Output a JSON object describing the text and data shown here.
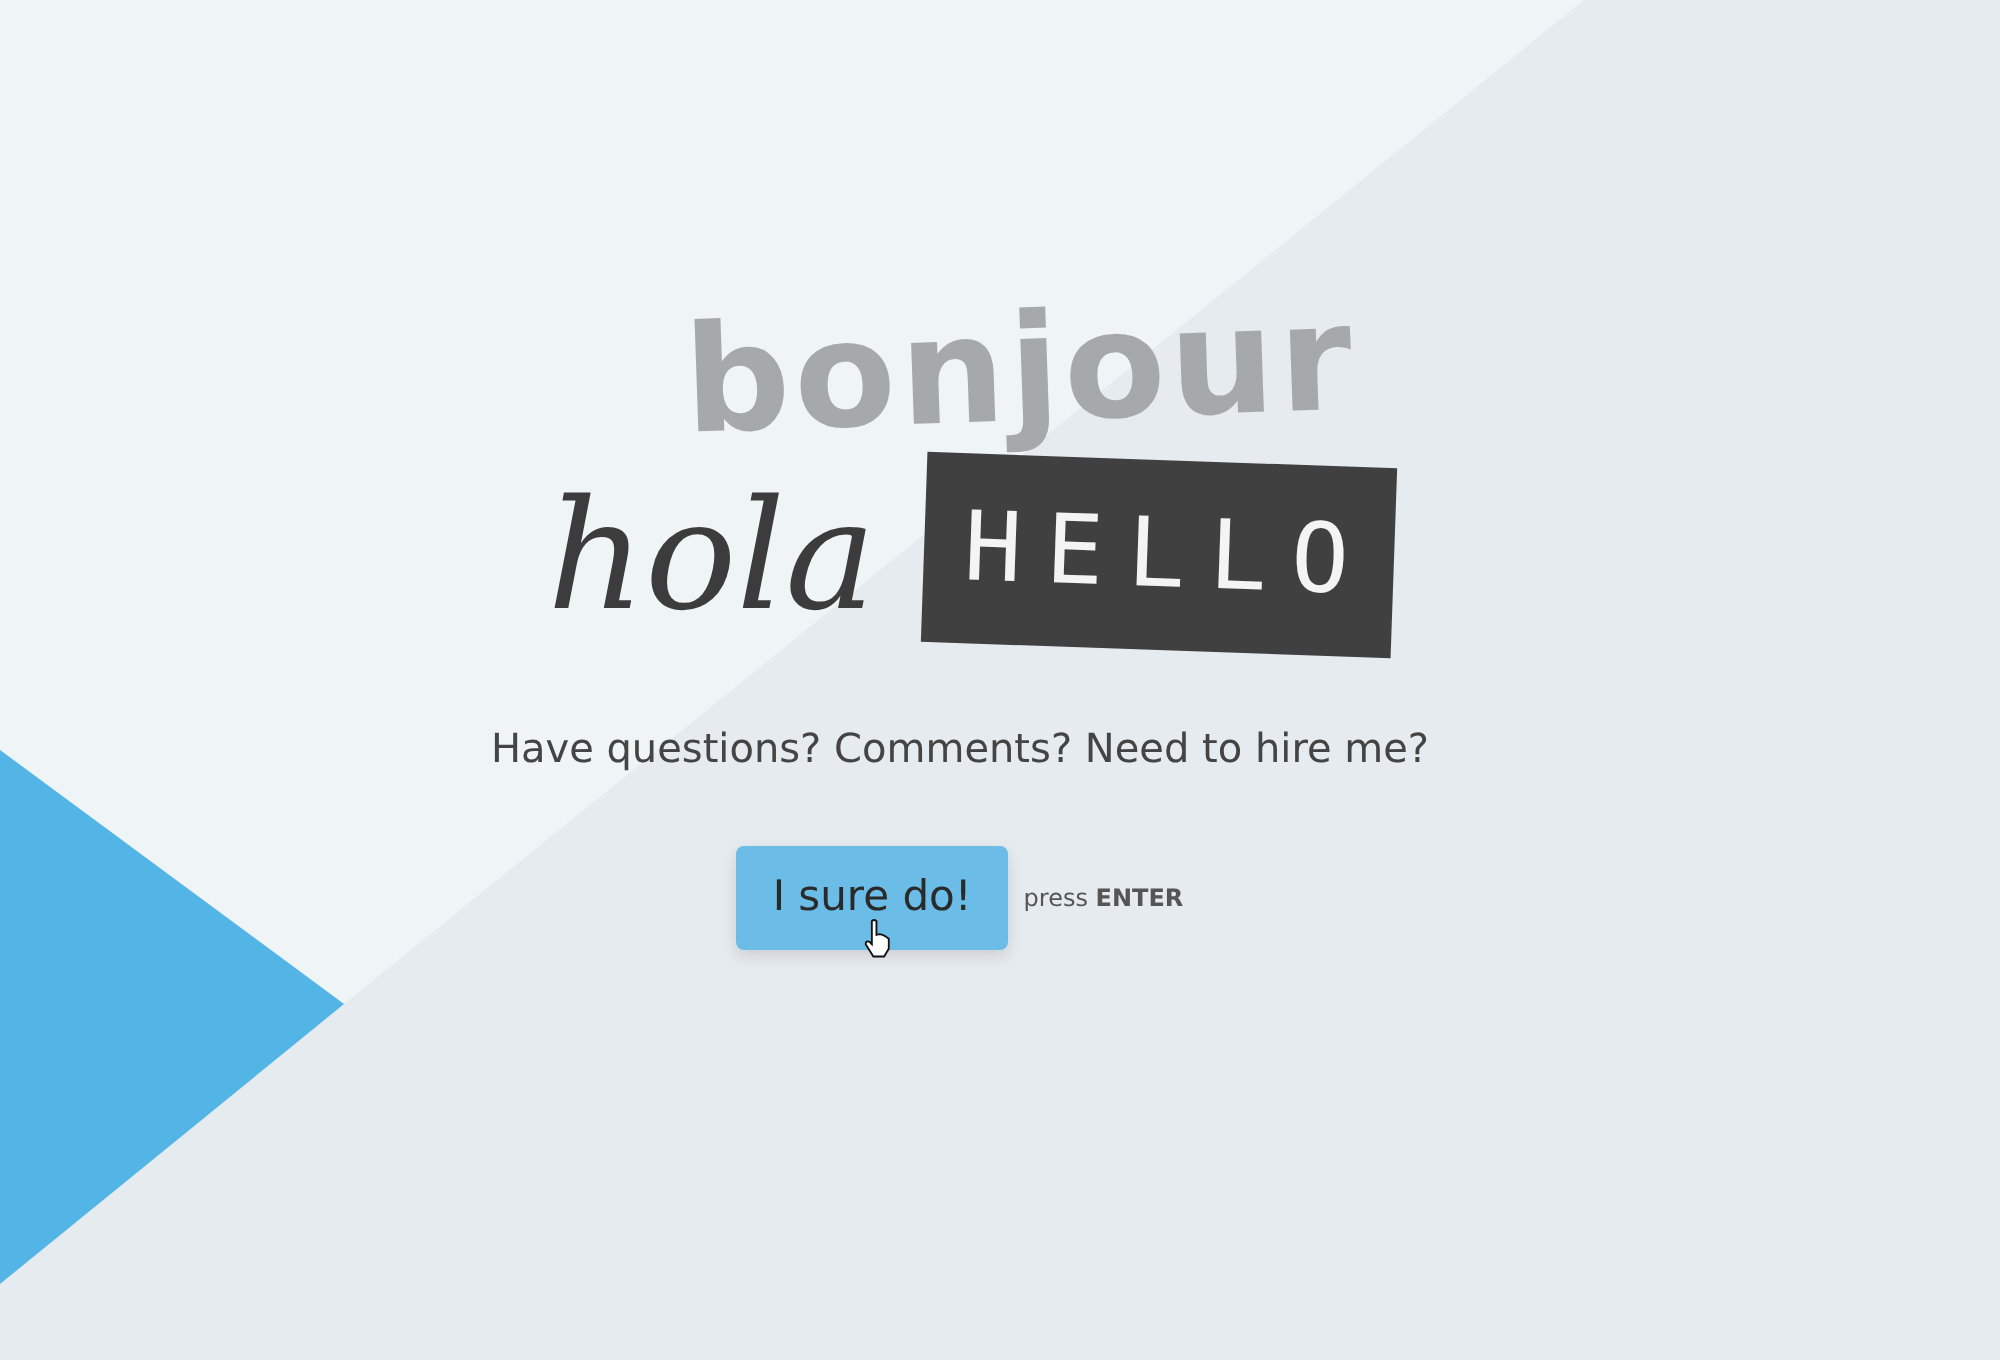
{
  "greetings": [
    {
      "text": "bonjour",
      "kind": "brush"
    },
    {
      "text": "hola",
      "kind": "script"
    },
    {
      "text": "HELLO",
      "kind": "label"
    }
  ],
  "prompt": "Have questions? Comments? Need to hire me?",
  "button": {
    "label": "I sure do!"
  },
  "hint": "press **ENTER**"
}
